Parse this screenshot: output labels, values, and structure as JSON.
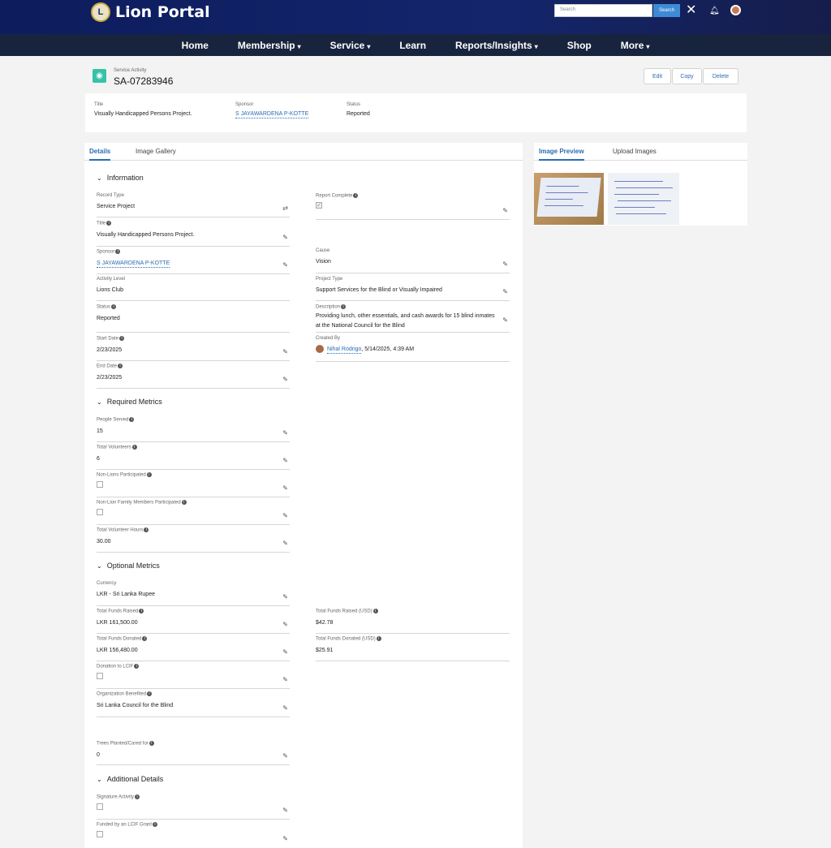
{
  "app": {
    "logo_mark": "L",
    "title": "Lion Portal",
    "search_placeholder": "Search",
    "search_button": "Search"
  },
  "nav": [
    {
      "label": "Home",
      "has_menu": false
    },
    {
      "label": "Membership",
      "has_menu": true
    },
    {
      "label": "Service",
      "has_menu": true
    },
    {
      "label": "Learn",
      "has_menu": false
    },
    {
      "label": "Reports/Insights",
      "has_menu": true
    },
    {
      "label": "Shop",
      "has_menu": false
    },
    {
      "label": "More",
      "has_menu": true
    }
  ],
  "record": {
    "kind": "Service Activity",
    "id": "SA-07283946",
    "actions": {
      "edit": "Edit",
      "copy": "Copy",
      "delete": "Delete"
    }
  },
  "highlights": {
    "title_label": "Title",
    "title_value": "Visually Handicapped Persons Project.",
    "sponsor_label": "Sponsor",
    "sponsor_value": "S JAYAWARDENA P-KOTTE",
    "status_label": "Status",
    "status_value": "Reported"
  },
  "tabs": {
    "details": "Details",
    "gallery": "Image Gallery"
  },
  "side_tabs": {
    "preview": "Image Preview",
    "upload": "Upload Images"
  },
  "sections": {
    "information": "Information",
    "required": "Required Metrics",
    "optional": "Optional Metrics",
    "additional": "Additional Details"
  },
  "fields": {
    "record_type": {
      "label": "Record Type",
      "value": "Service Project"
    },
    "title": {
      "label": "Title",
      "value": "Visually Handicapped Persons Project."
    },
    "sponsor": {
      "label": "Sponsor",
      "value": "S JAYAWARDENA P-KOTTE"
    },
    "activity_level": {
      "label": "Activity Level",
      "value": "Lions Club"
    },
    "status": {
      "label": "Status",
      "value": "Reported"
    },
    "start_date": {
      "label": "Start Date",
      "value": "2/23/2025"
    },
    "end_date": {
      "label": "End Date",
      "value": "2/23/2025"
    },
    "report_complete": {
      "label": "Report Complete",
      "checked": true
    },
    "cause": {
      "label": "Cause",
      "value": "Vision"
    },
    "project_type": {
      "label": "Project Type",
      "value": "Support Services for the Blind or Visually Impaired"
    },
    "description": {
      "label": "Description",
      "value": "Providing lunch, other essentials, and cash awards for 15 blind inmates at the National Council for the Blind"
    },
    "created_by": {
      "label": "Created By",
      "user": "Nihal Rodrigo",
      "when": ", 5/14/2025, 4:39 AM"
    },
    "people_served": {
      "label": "People Served",
      "value": "15"
    },
    "total_volunteers": {
      "label": "Total Volunteers",
      "value": "6"
    },
    "non_lions": {
      "label": "Non-Lions Participated",
      "checked": false
    },
    "non_lion_family": {
      "label": "Non-Lion Family Members Participated",
      "checked": false
    },
    "volunteer_hours": {
      "label": "Total Volunteer Hours",
      "value": "30.00"
    },
    "currency": {
      "label": "Currency",
      "value": "LKR - Sri Lanka Rupee"
    },
    "funds_raised": {
      "label": "Total Funds Raised",
      "value": "LKR 161,500.00"
    },
    "funds_donated": {
      "label": "Total Funds Donated",
      "value": "LKR 156,480.00"
    },
    "funds_raised_usd": {
      "label": "Total Funds Raised (USD)",
      "value": "$42.78"
    },
    "funds_donated_usd": {
      "label": "Total Funds Donated (USD)",
      "value": "$25.91"
    },
    "donation_lcif": {
      "label": "Donation to LCIF",
      "checked": false
    },
    "org_benefited": {
      "label": "Organization Benefited",
      "value": "Sri Lanka Council for the Blind"
    },
    "trees": {
      "label": "Trees Planted/Cared for",
      "value": "0"
    },
    "signature": {
      "label": "Signature Activity",
      "checked": false
    },
    "lcif_grant": {
      "label": "Funded by an LCIF Grant",
      "checked": false
    }
  },
  "icons": {
    "record": "service-activity-icon",
    "close": "close-icon",
    "bell": "bell-icon",
    "edit": "pencil-icon",
    "info": "info-icon",
    "chevron": "chevron-down-icon"
  },
  "colors": {
    "header": "#0c1c5c",
    "nav": "#18243e",
    "accent": "#2a6cb3",
    "record_icon": "#35c2a8"
  }
}
